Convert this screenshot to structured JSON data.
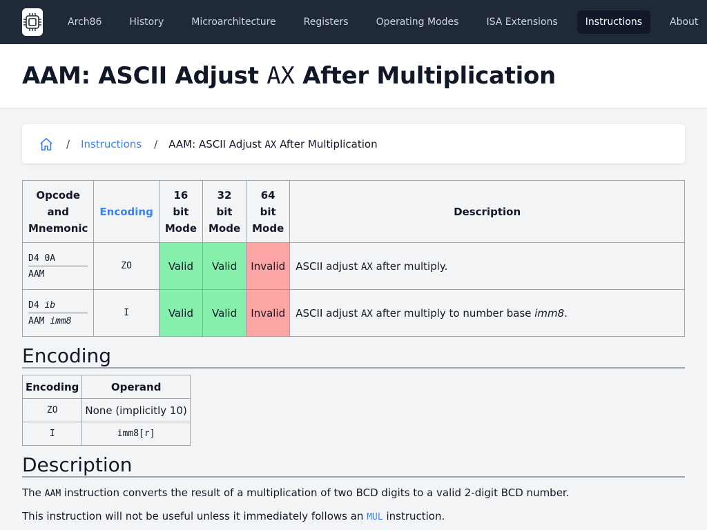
{
  "nav": {
    "items": [
      {
        "label": "Arch86",
        "active": false
      },
      {
        "label": "History",
        "active": false
      },
      {
        "label": "Microarchitecture",
        "active": false
      },
      {
        "label": "Registers",
        "active": false
      },
      {
        "label": "Operating Modes",
        "active": false
      },
      {
        "label": "ISA Extensions",
        "active": false
      },
      {
        "label": "Instructions",
        "active": true
      },
      {
        "label": "About",
        "active": false
      }
    ],
    "logo_icon": "cpu-chip-icon"
  },
  "page": {
    "title_prefix": "AAM: ASCII Adjust ",
    "title_reg": "AX",
    "title_suffix": " After Multiplication"
  },
  "breadcrumb": {
    "home_icon": "home-icon",
    "link": "Instructions",
    "sep": "/",
    "current_prefix": "AAM: ASCII Adjust ",
    "current_reg": "AX",
    "current_suffix": " After Multiplication"
  },
  "instr_table": {
    "headers": {
      "opcode": "Opcode and Mnemonic",
      "encoding": "Encoding",
      "mode16": "16 bit Mode",
      "mode32": "32 bit Mode",
      "mode64": "64 bit Mode",
      "description": "Description"
    },
    "rows": [
      {
        "opcode": "D4 0A",
        "opcode_operand": "",
        "mnemonic": "AAM",
        "mnemonic_operand": "",
        "encoding": "ZO",
        "mode16": "Valid",
        "mode32": "Valid",
        "mode64": "Invalid",
        "desc_prefix": "ASCII adjust ",
        "desc_reg": "AX",
        "desc_suffix": " after multiply.",
        "desc_italic": "",
        "desc_end": ""
      },
      {
        "opcode": "D4 ",
        "opcode_operand": "ib",
        "mnemonic": "AAM ",
        "mnemonic_operand": "imm8",
        "encoding": "I",
        "mode16": "Valid",
        "mode32": "Valid",
        "mode64": "Invalid",
        "desc_prefix": "ASCII adjust ",
        "desc_reg": "AX",
        "desc_suffix": " after multiply to number base ",
        "desc_italic": "imm8",
        "desc_end": "."
      }
    ],
    "colors": {
      "valid": "#86efac",
      "invalid": "#fca5a5"
    }
  },
  "encoding_section": {
    "heading": "Encoding",
    "headers": {
      "encoding": "Encoding",
      "operand": "Operand"
    },
    "rows": [
      {
        "encoding": "ZO",
        "operand": "None (implicitly 10)",
        "operand_mono": false
      },
      {
        "encoding": "I",
        "operand": "imm8[r]",
        "operand_mono": true
      }
    ]
  },
  "description_section": {
    "heading": "Description",
    "p1_prefix": "The ",
    "p1_code": "AAM",
    "p1_suffix": " instruction converts the result of a multiplication of two BCD digits to a valid 2-digit BCD number.",
    "p2_prefix": "This instruction will not be useful unless it immediately follows an ",
    "p2_link": "MUL",
    "p2_suffix": " instruction."
  }
}
